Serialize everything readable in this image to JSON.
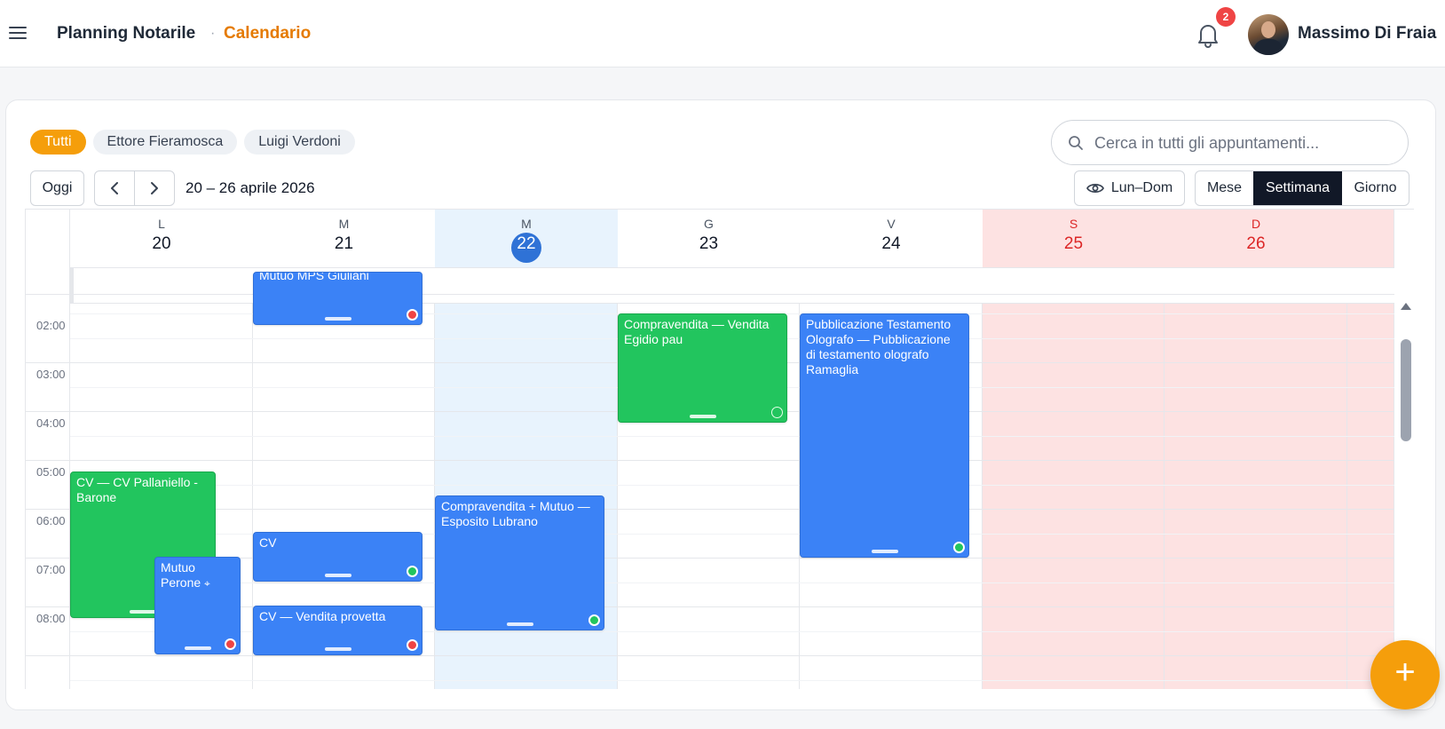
{
  "header": {
    "app_title": "Planning Notarile",
    "separator": "·",
    "page_title": "Calendario",
    "notifications_count": "2",
    "user_name": "Massimo Di Fraia"
  },
  "filters": {
    "chips": [
      {
        "label": "Tutti",
        "active": true
      },
      {
        "label": "Ettore Fieramosca",
        "active": false
      },
      {
        "label": "Luigi Verdoni",
        "active": false
      }
    ]
  },
  "search": {
    "placeholder": "Cerca in tutti gli appuntamenti..."
  },
  "toolbar": {
    "today_label": "Oggi",
    "range_label": "20 – 26 aprile 2026",
    "lundom_label": "Lun–Dom",
    "views": [
      "Mese",
      "Settimana",
      "Giorno"
    ],
    "active_view": "Settimana"
  },
  "calendar": {
    "days": [
      {
        "letter": "L",
        "number": "20",
        "today": false,
        "weekend": false
      },
      {
        "letter": "M",
        "number": "21",
        "today": false,
        "weekend": false
      },
      {
        "letter": "M",
        "number": "22",
        "today": true,
        "weekend": false
      },
      {
        "letter": "G",
        "number": "23",
        "today": false,
        "weekend": false
      },
      {
        "letter": "V",
        "number": "24",
        "today": false,
        "weekend": false
      },
      {
        "letter": "S",
        "number": "25",
        "today": false,
        "weekend": true
      },
      {
        "letter": "D",
        "number": "26",
        "today": false,
        "weekend": true
      }
    ],
    "time_labels": [
      "02:00",
      "03:00",
      "04:00",
      "05:00",
      "06:00",
      "07:00",
      "08:00"
    ],
    "events": [
      {
        "title": "Mutuo MPS Giuliani",
        "day": 1,
        "color": "blue",
        "status": "red",
        "note": "partially visible, cut at top"
      },
      {
        "title": "Compravendita — Vendita Egidio pau",
        "day": 3,
        "color": "green",
        "status": "hollow"
      },
      {
        "title": "Pubblicazione Testamento Olografo — Pubblicazione di testamento olografo Ramaglia",
        "day": 4,
        "color": "blue",
        "status": "green"
      },
      {
        "title": "CV — CV Pallaniello - Barone",
        "day": 0,
        "color": "green",
        "status": "none"
      },
      {
        "title": "Mutuo Perone",
        "day": 0,
        "color": "blue",
        "status": "red",
        "pinned": true
      },
      {
        "title": "Compravendita + Mutuo — Esposito Lubrano",
        "day": 2,
        "color": "blue",
        "status": "green"
      },
      {
        "title": "CV",
        "day": 1,
        "color": "blue",
        "status": "green"
      },
      {
        "title": "CV — Vendita provetta",
        "day": 1,
        "color": "blue",
        "status": "red"
      }
    ]
  },
  "colors": {
    "accent": "#f59e0b",
    "title_orange": "#e57a00",
    "event_blue": "#3b82f6",
    "event_green": "#22c55e",
    "today_blue": "#2f72d6",
    "today_column": "#e8f3fd",
    "weekend_column": "#fde2e2",
    "status_red": "#ef4444"
  },
  "fab": {
    "label": "+"
  }
}
